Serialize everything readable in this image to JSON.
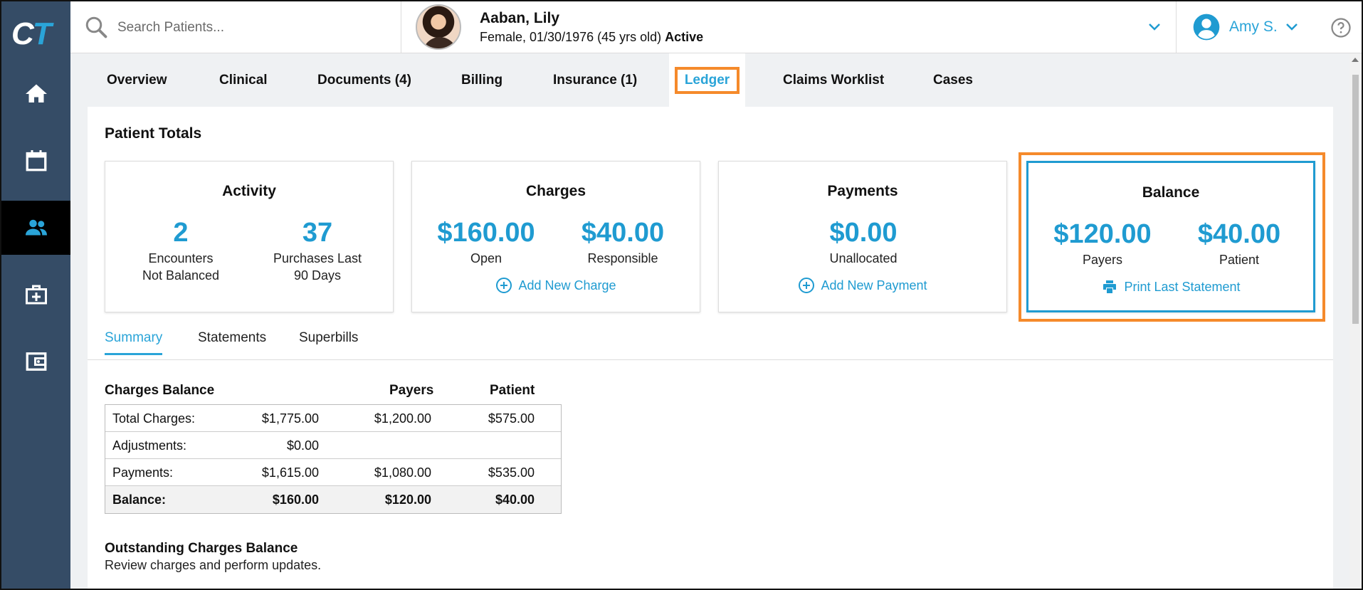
{
  "app": {
    "logo_c": "C",
    "logo_t": "T"
  },
  "sidebar": {
    "items": [
      {
        "icon": "home-icon"
      },
      {
        "icon": "calendar-icon"
      },
      {
        "icon": "patients-icon",
        "active": true
      },
      {
        "icon": "medical-kit-icon"
      },
      {
        "icon": "wallet-icon"
      }
    ]
  },
  "search": {
    "placeholder": "Search Patients..."
  },
  "patient": {
    "name": "Aaban, Lily",
    "info": "Female, 01/30/1976 (45 yrs old)",
    "status": "Active"
  },
  "user": {
    "name": "Amy S."
  },
  "tabs": [
    {
      "label": "Overview"
    },
    {
      "label": "Clinical"
    },
    {
      "label": "Documents (4)"
    },
    {
      "label": "Billing"
    },
    {
      "label": "Insurance (1)"
    },
    {
      "label": "Ledger",
      "active": true
    },
    {
      "label": "Claims Worklist"
    },
    {
      "label": "Cases"
    }
  ],
  "patient_totals": {
    "title": "Patient Totals",
    "activity": {
      "title": "Activity",
      "m1_value": "2",
      "m1_label_1": "Encounters",
      "m1_label_2": "Not Balanced",
      "m2_value": "37",
      "m2_label_1": "Purchases Last",
      "m2_label_2": "90 Days"
    },
    "charges": {
      "title": "Charges",
      "m1_value": "$160.00",
      "m1_label": "Open",
      "m2_value": "$40.00",
      "m2_label": "Responsible",
      "action": "Add New Charge"
    },
    "payments": {
      "title": "Payments",
      "m1_value": "$0.00",
      "m1_label": "Unallocated",
      "action": "Add New Payment"
    },
    "balance": {
      "title": "Balance",
      "m1_value": "$120.00",
      "m1_label": "Payers",
      "m2_value": "$40.00",
      "m2_label": "Patient",
      "action": "Print Last Statement"
    }
  },
  "subtabs": [
    {
      "label": "Summary",
      "active": true
    },
    {
      "label": "Statements"
    },
    {
      "label": "Superbills"
    }
  ],
  "charges_balance": {
    "headers": {
      "title": "Charges Balance",
      "payers": "Payers",
      "patient": "Patient"
    },
    "rows": [
      {
        "label": "Total Charges:",
        "total": "$1,775.00",
        "payers": "$1,200.00",
        "patient": "$575.00"
      },
      {
        "label": "Adjustments:",
        "total": "$0.00",
        "payers": "",
        "patient": ""
      },
      {
        "label": "Payments:",
        "total": "$1,615.00",
        "payers": "$1,080.00",
        "patient": "$535.00"
      },
      {
        "label": "Balance:",
        "total": "$160.00",
        "payers": "$120.00",
        "patient": "$40.00"
      }
    ]
  },
  "outstanding": {
    "title": "Outstanding Charges Balance",
    "subtitle": "Review charges and perform updates."
  },
  "colors": {
    "accent": "#1f9bd1",
    "sidebar": "#354c66",
    "highlight": "#f58a2b"
  }
}
